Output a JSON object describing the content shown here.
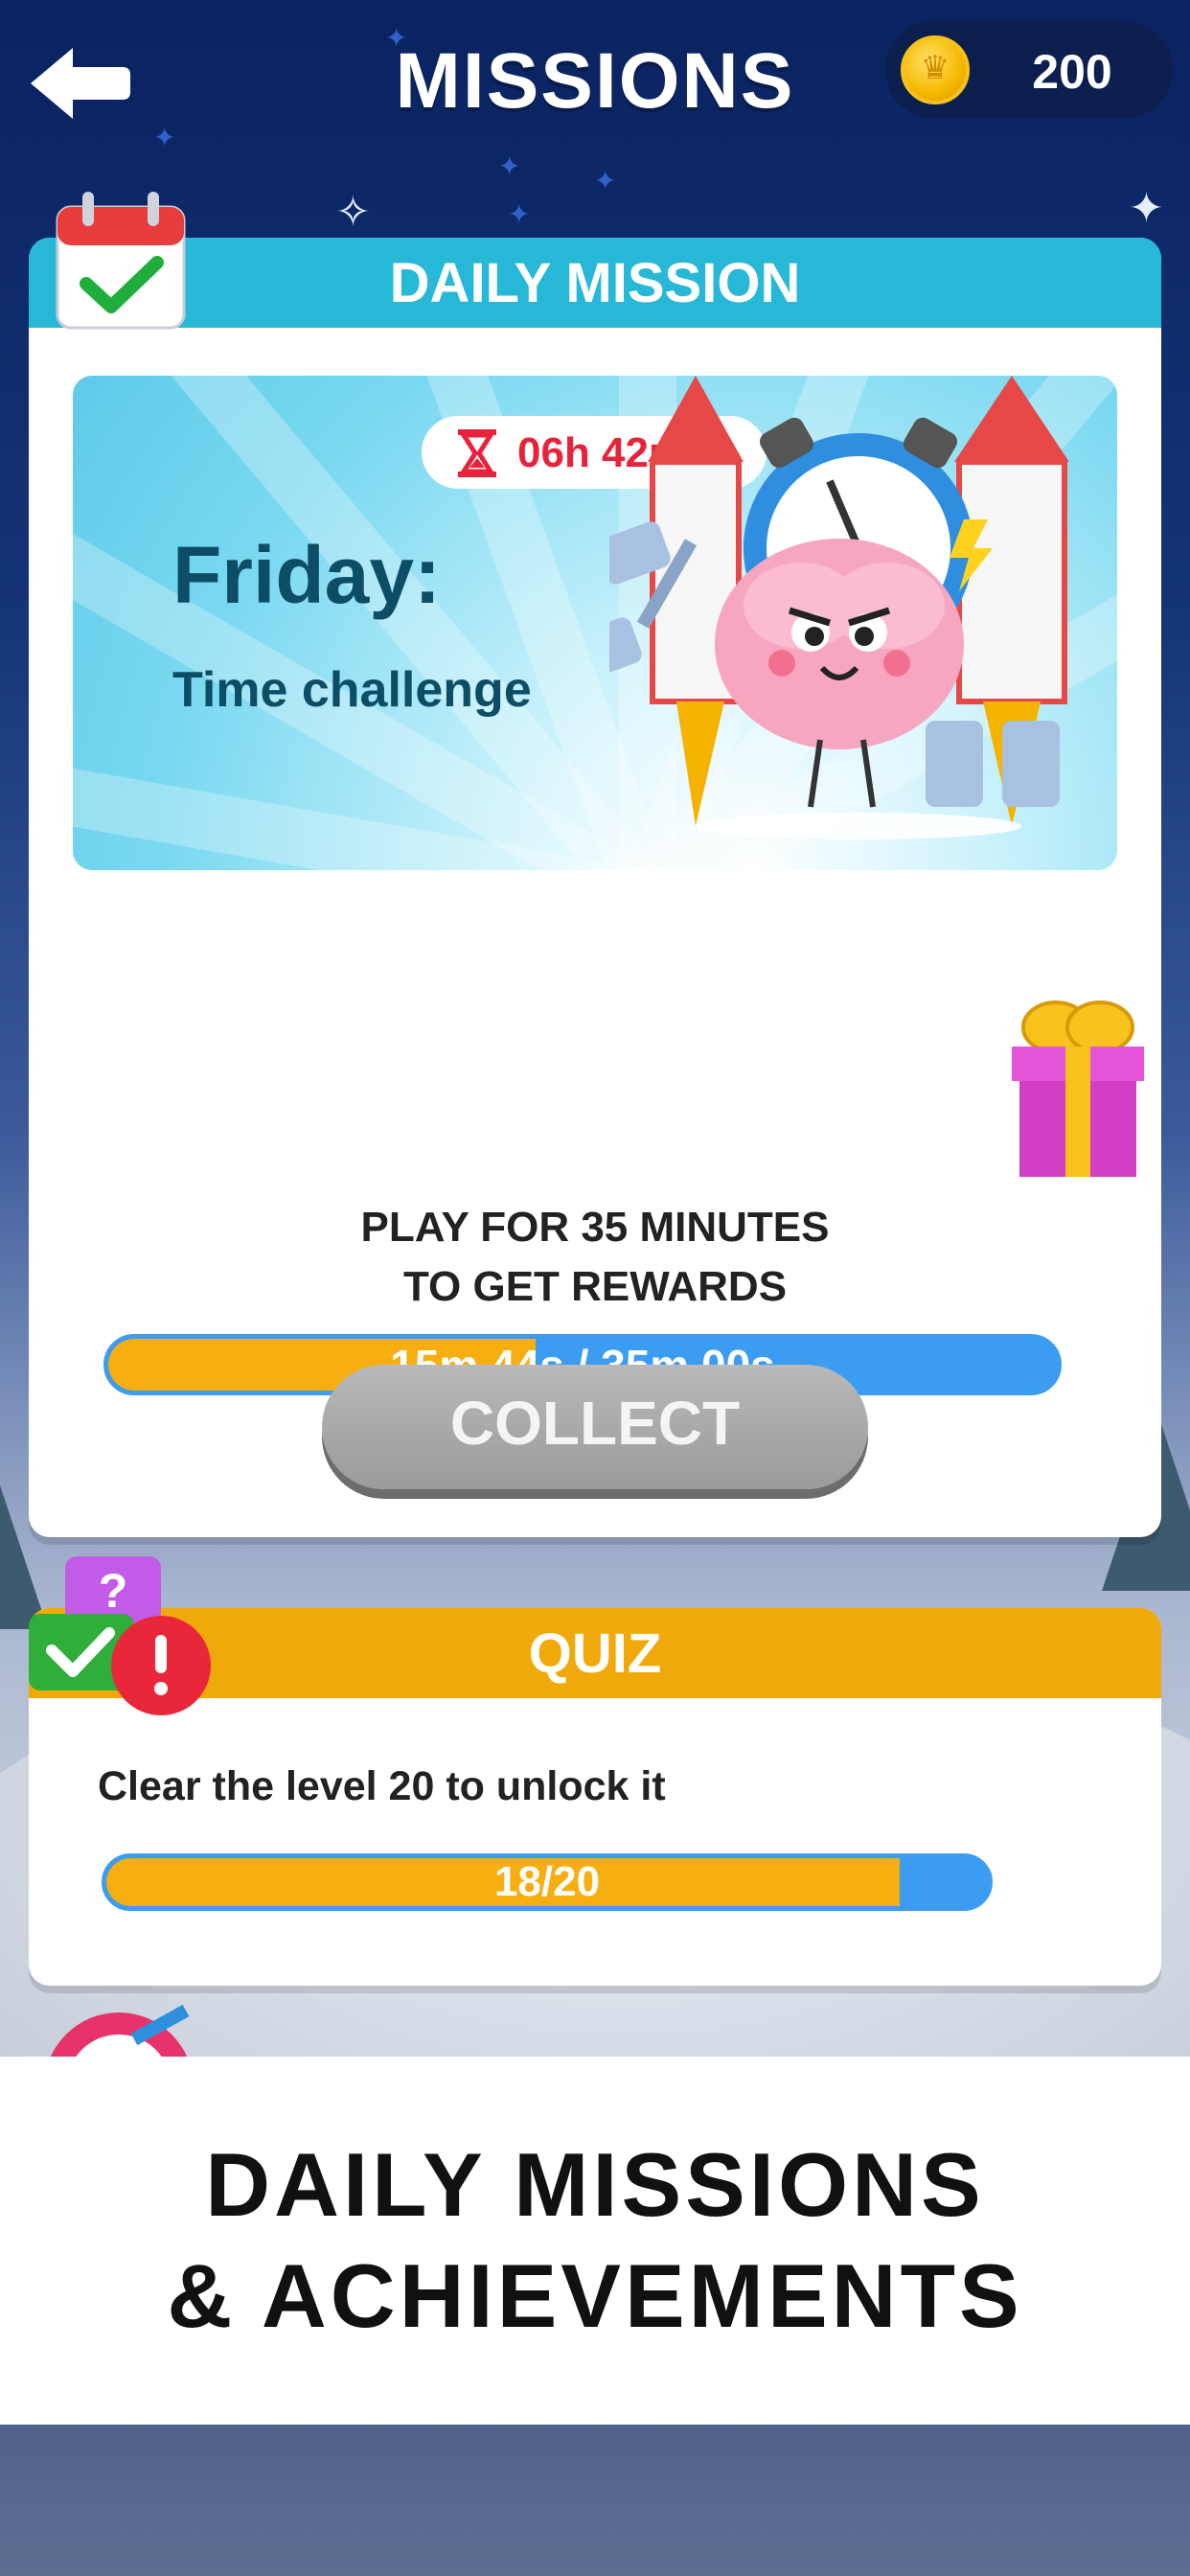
{
  "header": {
    "title": "MISSIONS",
    "coins": "200"
  },
  "daily_mission": {
    "title": "DAILY MISSION",
    "timer": "06h 42m",
    "day": "Friday:",
    "challenge": "Time challenge",
    "progress_text": "15m 44s / 35m 00s",
    "progress_fraction": 0.45,
    "instruction_line1": "PLAY FOR 35 MINUTES",
    "instruction_line2": "TO GET REWARDS",
    "collect_label": "COLLECT"
  },
  "quiz": {
    "title": "QUIZ",
    "description": "Clear the level 20 to unlock it",
    "progress_text": "18/20",
    "progress_fraction": 0.9
  },
  "caption": {
    "line1": "DAILY MISSIONS",
    "line2": "& ACHIEVEMENTS"
  },
  "icons": {
    "back": "back-arrow-icon",
    "coin": "coin-icon",
    "calendar": "calendar-check-icon",
    "hourglass": "hourglass-icon",
    "gift": "gift-icon",
    "quiz": "quiz-bubbles-icon",
    "target": "target-icon"
  },
  "colors": {
    "daily_header": "#26b8d6",
    "quiz_header": "#f0a90a",
    "progress_fill": "#f6ae10",
    "progress_track": "#3b9cf2",
    "timer_text": "#e8223b"
  }
}
